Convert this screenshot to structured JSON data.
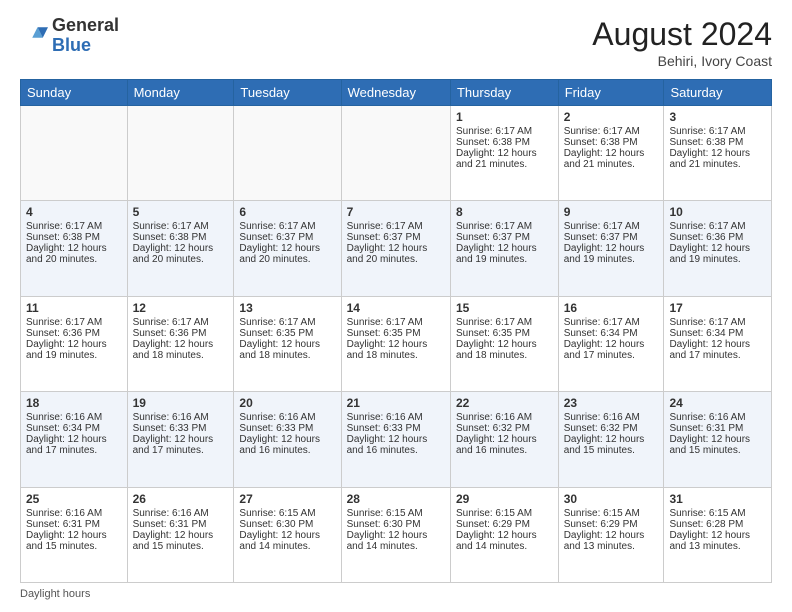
{
  "header": {
    "logo_general": "General",
    "logo_blue": "Blue",
    "month_title": "August 2024",
    "location": "Behiri, Ivory Coast"
  },
  "footer": {
    "daylight_label": "Daylight hours"
  },
  "days_of_week": [
    "Sunday",
    "Monday",
    "Tuesday",
    "Wednesday",
    "Thursday",
    "Friday",
    "Saturday"
  ],
  "weeks": [
    {
      "alt": false,
      "days": [
        {
          "num": "",
          "text": ""
        },
        {
          "num": "",
          "text": ""
        },
        {
          "num": "",
          "text": ""
        },
        {
          "num": "",
          "text": ""
        },
        {
          "num": "1",
          "text": "Sunrise: 6:17 AM\nSunset: 6:38 PM\nDaylight: 12 hours and 21 minutes."
        },
        {
          "num": "2",
          "text": "Sunrise: 6:17 AM\nSunset: 6:38 PM\nDaylight: 12 hours and 21 minutes."
        },
        {
          "num": "3",
          "text": "Sunrise: 6:17 AM\nSunset: 6:38 PM\nDaylight: 12 hours and 21 minutes."
        }
      ]
    },
    {
      "alt": true,
      "days": [
        {
          "num": "4",
          "text": "Sunrise: 6:17 AM\nSunset: 6:38 PM\nDaylight: 12 hours and 20 minutes."
        },
        {
          "num": "5",
          "text": "Sunrise: 6:17 AM\nSunset: 6:38 PM\nDaylight: 12 hours and 20 minutes."
        },
        {
          "num": "6",
          "text": "Sunrise: 6:17 AM\nSunset: 6:37 PM\nDaylight: 12 hours and 20 minutes."
        },
        {
          "num": "7",
          "text": "Sunrise: 6:17 AM\nSunset: 6:37 PM\nDaylight: 12 hours and 20 minutes."
        },
        {
          "num": "8",
          "text": "Sunrise: 6:17 AM\nSunset: 6:37 PM\nDaylight: 12 hours and 19 minutes."
        },
        {
          "num": "9",
          "text": "Sunrise: 6:17 AM\nSunset: 6:37 PM\nDaylight: 12 hours and 19 minutes."
        },
        {
          "num": "10",
          "text": "Sunrise: 6:17 AM\nSunset: 6:36 PM\nDaylight: 12 hours and 19 minutes."
        }
      ]
    },
    {
      "alt": false,
      "days": [
        {
          "num": "11",
          "text": "Sunrise: 6:17 AM\nSunset: 6:36 PM\nDaylight: 12 hours and 19 minutes."
        },
        {
          "num": "12",
          "text": "Sunrise: 6:17 AM\nSunset: 6:36 PM\nDaylight: 12 hours and 18 minutes."
        },
        {
          "num": "13",
          "text": "Sunrise: 6:17 AM\nSunset: 6:35 PM\nDaylight: 12 hours and 18 minutes."
        },
        {
          "num": "14",
          "text": "Sunrise: 6:17 AM\nSunset: 6:35 PM\nDaylight: 12 hours and 18 minutes."
        },
        {
          "num": "15",
          "text": "Sunrise: 6:17 AM\nSunset: 6:35 PM\nDaylight: 12 hours and 18 minutes."
        },
        {
          "num": "16",
          "text": "Sunrise: 6:17 AM\nSunset: 6:34 PM\nDaylight: 12 hours and 17 minutes."
        },
        {
          "num": "17",
          "text": "Sunrise: 6:17 AM\nSunset: 6:34 PM\nDaylight: 12 hours and 17 minutes."
        }
      ]
    },
    {
      "alt": true,
      "days": [
        {
          "num": "18",
          "text": "Sunrise: 6:16 AM\nSunset: 6:34 PM\nDaylight: 12 hours and 17 minutes."
        },
        {
          "num": "19",
          "text": "Sunrise: 6:16 AM\nSunset: 6:33 PM\nDaylight: 12 hours and 17 minutes."
        },
        {
          "num": "20",
          "text": "Sunrise: 6:16 AM\nSunset: 6:33 PM\nDaylight: 12 hours and 16 minutes."
        },
        {
          "num": "21",
          "text": "Sunrise: 6:16 AM\nSunset: 6:33 PM\nDaylight: 12 hours and 16 minutes."
        },
        {
          "num": "22",
          "text": "Sunrise: 6:16 AM\nSunset: 6:32 PM\nDaylight: 12 hours and 16 minutes."
        },
        {
          "num": "23",
          "text": "Sunrise: 6:16 AM\nSunset: 6:32 PM\nDaylight: 12 hours and 15 minutes."
        },
        {
          "num": "24",
          "text": "Sunrise: 6:16 AM\nSunset: 6:31 PM\nDaylight: 12 hours and 15 minutes."
        }
      ]
    },
    {
      "alt": false,
      "days": [
        {
          "num": "25",
          "text": "Sunrise: 6:16 AM\nSunset: 6:31 PM\nDaylight: 12 hours and 15 minutes."
        },
        {
          "num": "26",
          "text": "Sunrise: 6:16 AM\nSunset: 6:31 PM\nDaylight: 12 hours and 15 minutes."
        },
        {
          "num": "27",
          "text": "Sunrise: 6:15 AM\nSunset: 6:30 PM\nDaylight: 12 hours and 14 minutes."
        },
        {
          "num": "28",
          "text": "Sunrise: 6:15 AM\nSunset: 6:30 PM\nDaylight: 12 hours and 14 minutes."
        },
        {
          "num": "29",
          "text": "Sunrise: 6:15 AM\nSunset: 6:29 PM\nDaylight: 12 hours and 14 minutes."
        },
        {
          "num": "30",
          "text": "Sunrise: 6:15 AM\nSunset: 6:29 PM\nDaylight: 12 hours and 13 minutes."
        },
        {
          "num": "31",
          "text": "Sunrise: 6:15 AM\nSunset: 6:28 PM\nDaylight: 12 hours and 13 minutes."
        }
      ]
    }
  ]
}
